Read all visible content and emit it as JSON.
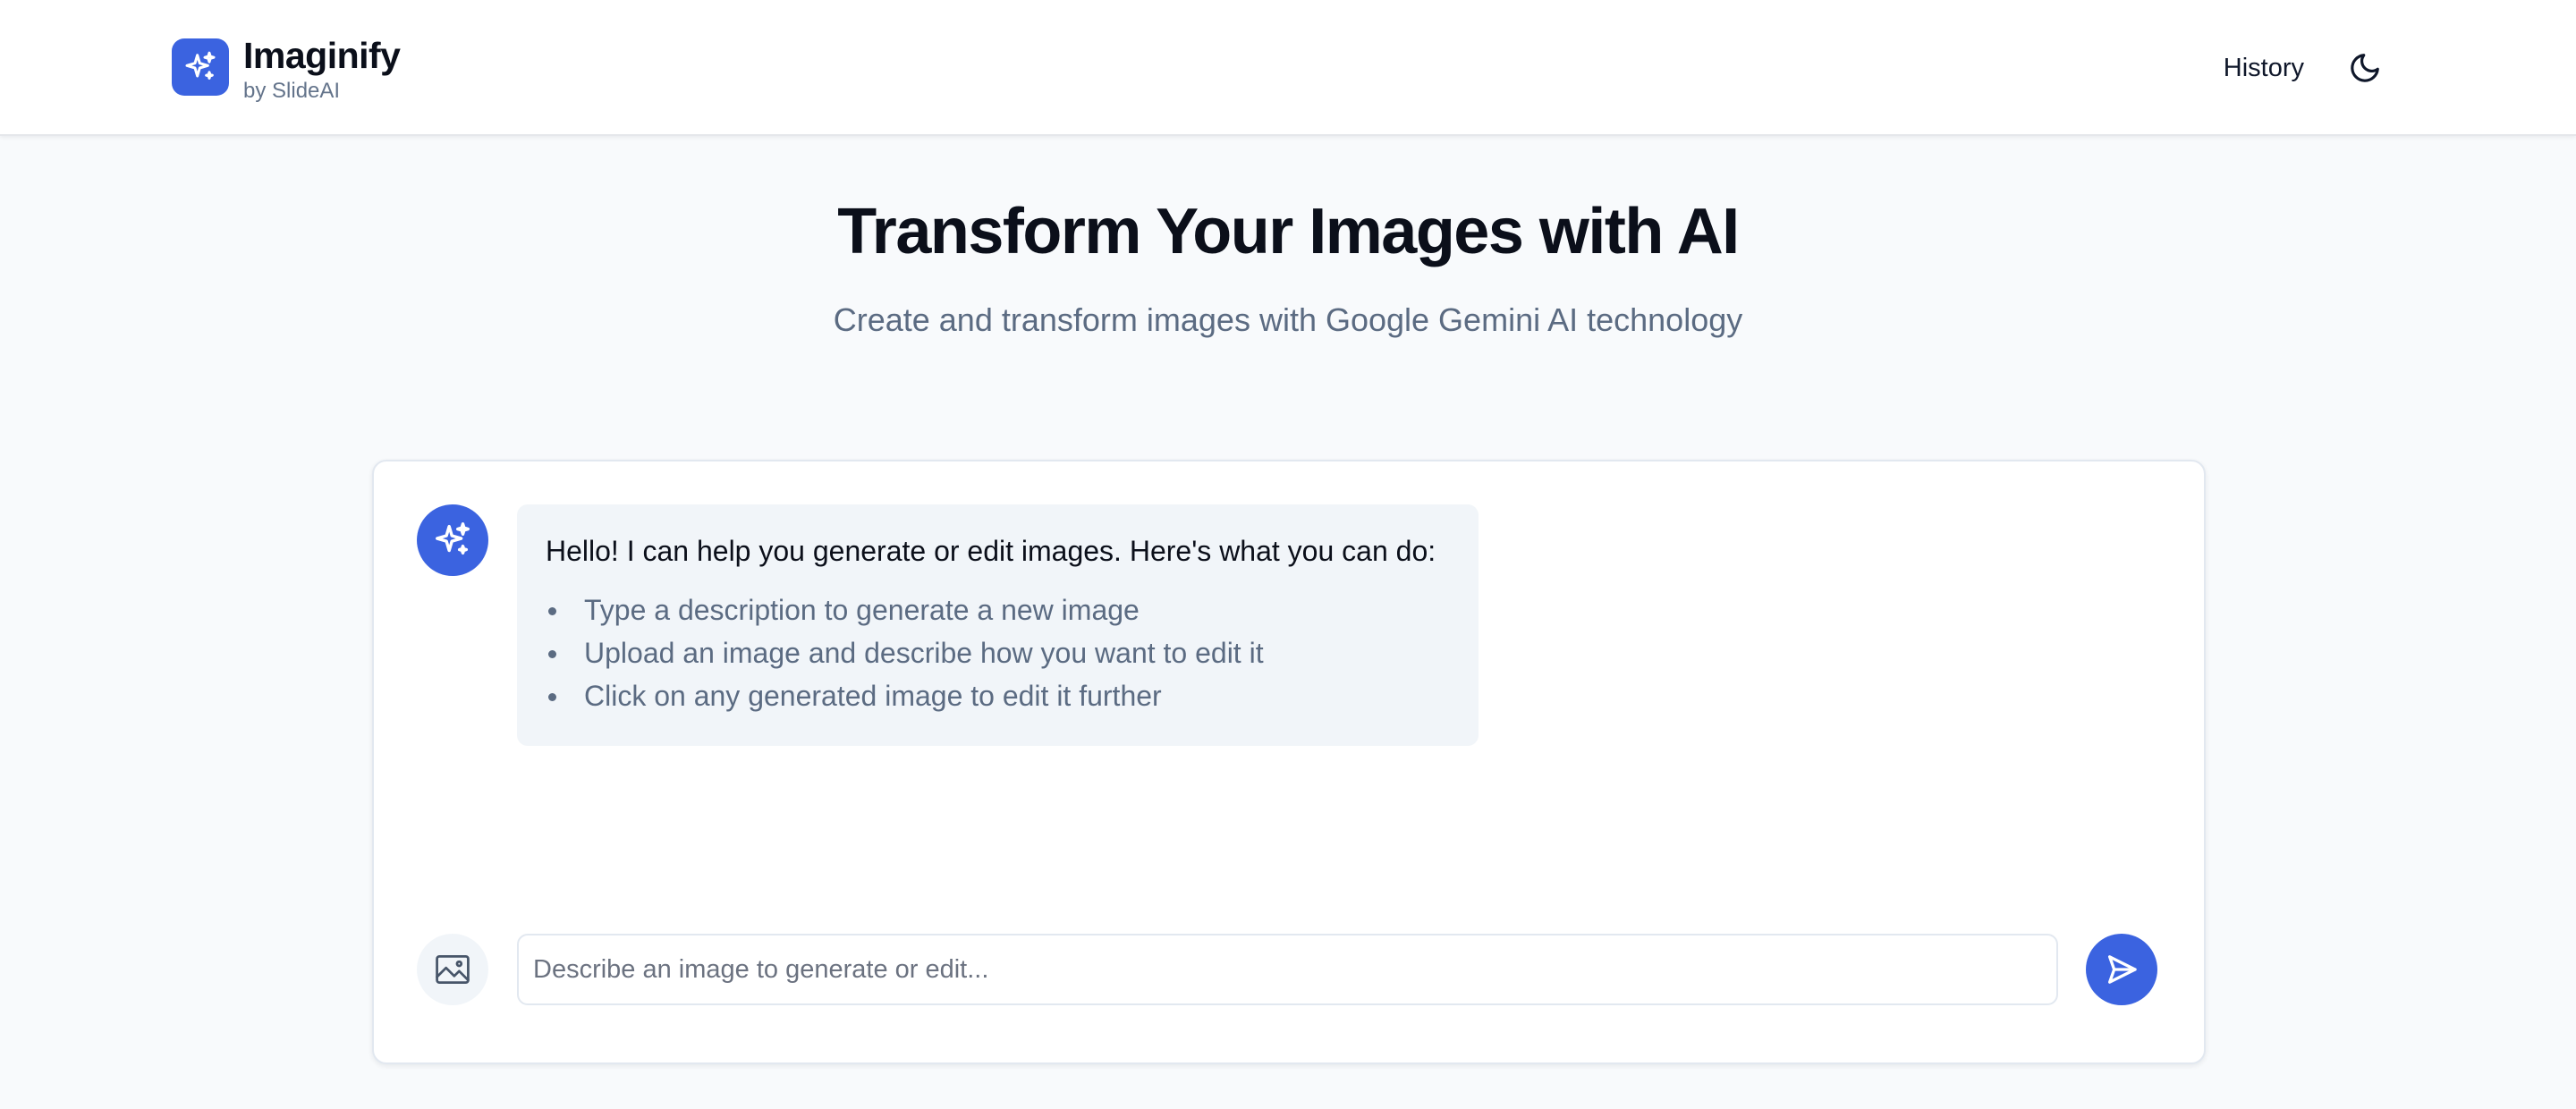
{
  "app": {
    "name": "Imaginify",
    "byline": "by SlideAI"
  },
  "header": {
    "history_label": "History",
    "theme_icon": "moon-icon"
  },
  "hero": {
    "title": "Transform Your Images with AI",
    "subtitle": "Create and transform images with Google Gemini AI technology"
  },
  "chat": {
    "assistant_icon": "sparkles-icon",
    "welcome": {
      "intro": "Hello! I can help you generate or edit images. Here's what you can do:",
      "items": [
        "Type a description to generate a new image",
        "Upload an image and describe how you want to edit it",
        "Click on any generated image to edit it further"
      ]
    }
  },
  "composer": {
    "placeholder": "Describe an image to generate or edit...",
    "value": "",
    "upload_icon": "image-icon",
    "send_icon": "send-icon"
  },
  "colors": {
    "accent": "#3b63e0",
    "bubble_bg": "#f1f5f9",
    "muted_text": "#5b6b82"
  }
}
